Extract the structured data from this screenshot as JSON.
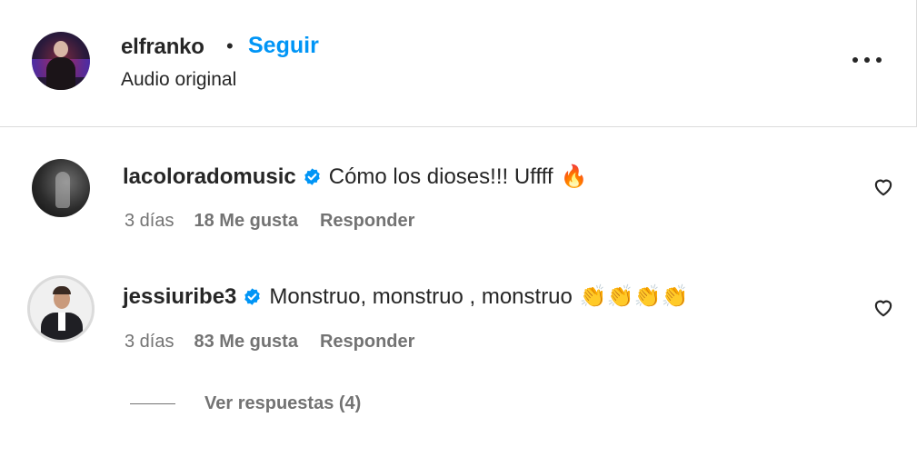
{
  "post_header": {
    "username": "elfranko",
    "separator": "•",
    "follow_label": "Seguir",
    "subtitle": "Audio original",
    "more_icon": "more-horizontal-icon"
  },
  "comments": [
    {
      "username": "lacoloradomusic",
      "verified": true,
      "text": "Cómo los dioses!!! Uffff",
      "emoji": "🔥",
      "time": "3 días",
      "likes": "18 Me gusta",
      "reply_label": "Responder"
    },
    {
      "username": "jessiuribe3",
      "verified": true,
      "text": "Monstruo, monstruo , monstruo",
      "emoji": "👏👏👏👏",
      "time": "3 días",
      "likes": "83 Me gusta",
      "reply_label": "Responder",
      "view_replies": "Ver respuestas (4)"
    }
  ],
  "colors": {
    "accent": "#0095f6",
    "verified": "#0095f6",
    "text": "#262626",
    "muted": "#737373",
    "border": "#dbdbdb"
  }
}
